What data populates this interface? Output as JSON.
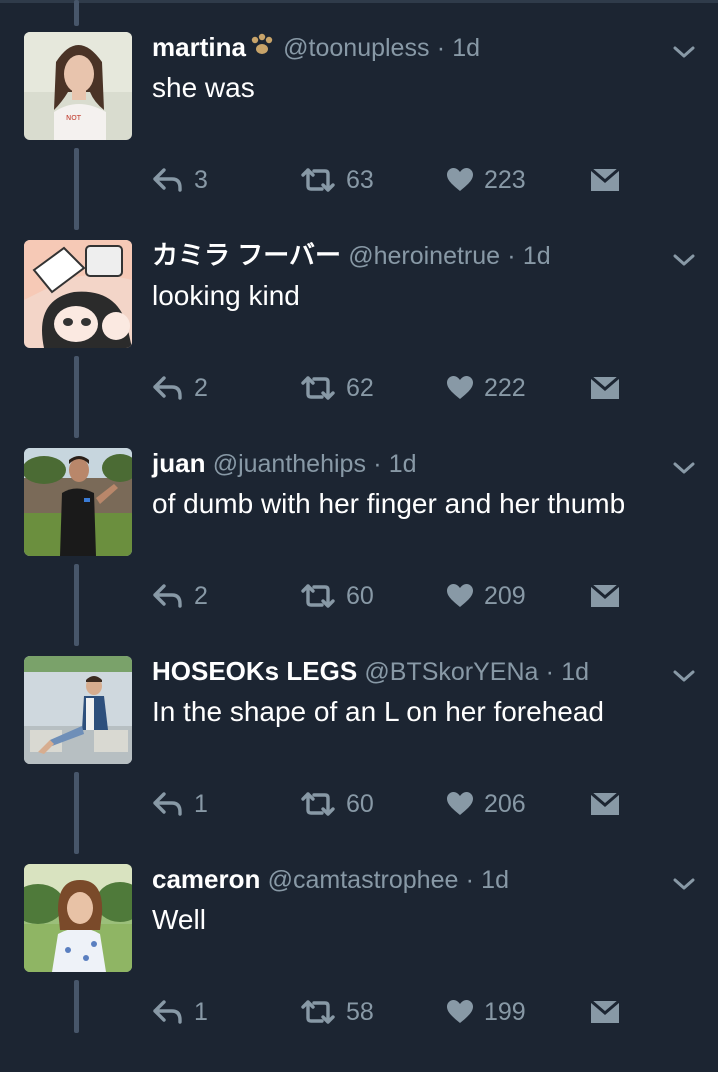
{
  "tweets": [
    {
      "name": "martina",
      "handle": "@toonupless",
      "time": "1d",
      "text": "she was",
      "replies": "3",
      "retweets": "63",
      "likes": "223",
      "avatar": "girl-portrait"
    },
    {
      "name": "カミラ フーバー",
      "handle": "@heroinetrue",
      "time": "1d",
      "text": "looking kind",
      "replies": "2",
      "retweets": "62",
      "likes": "222",
      "avatar": "anime-drawing"
    },
    {
      "name": "juan",
      "handle": "@juanthehips",
      "time": "1d",
      "text": "of dumb with her finger and her thumb",
      "replies": "2",
      "retweets": "60",
      "likes": "209",
      "avatar": "man-in-yard"
    },
    {
      "name": "HOSEOKs LEGS",
      "handle": "@BTSkorYENa",
      "time": "1d",
      "text": "In the shape of an L on her forehead",
      "replies": "1",
      "retweets": "60",
      "likes": "206",
      "avatar": "person-sitting"
    },
    {
      "name": "cameron",
      "handle": "@camtastrophee",
      "time": "1d",
      "text": "Well",
      "replies": "1",
      "retweets": "58",
      "likes": "199",
      "avatar": "woman-in-field"
    }
  ],
  "separator": "·",
  "colors": {
    "background": "#1c2532",
    "muted": "#8899a6",
    "thread": "#47566a"
  }
}
